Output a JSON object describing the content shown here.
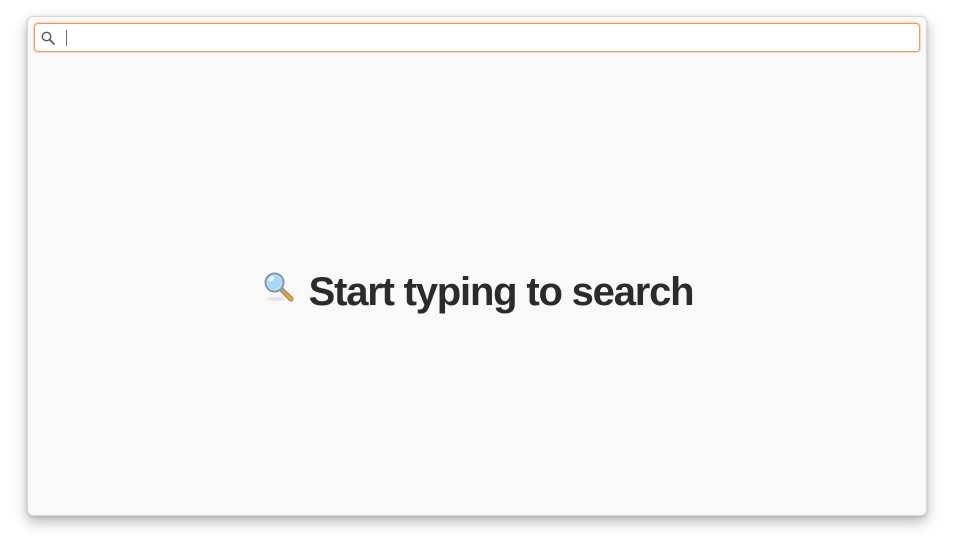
{
  "search": {
    "value": "",
    "placeholder": "",
    "icon": "search-icon",
    "focus_color": "#f19a5a"
  },
  "empty_state": {
    "icon": "magnifying-glass-emoji-icon",
    "message": "Start typing to search"
  }
}
